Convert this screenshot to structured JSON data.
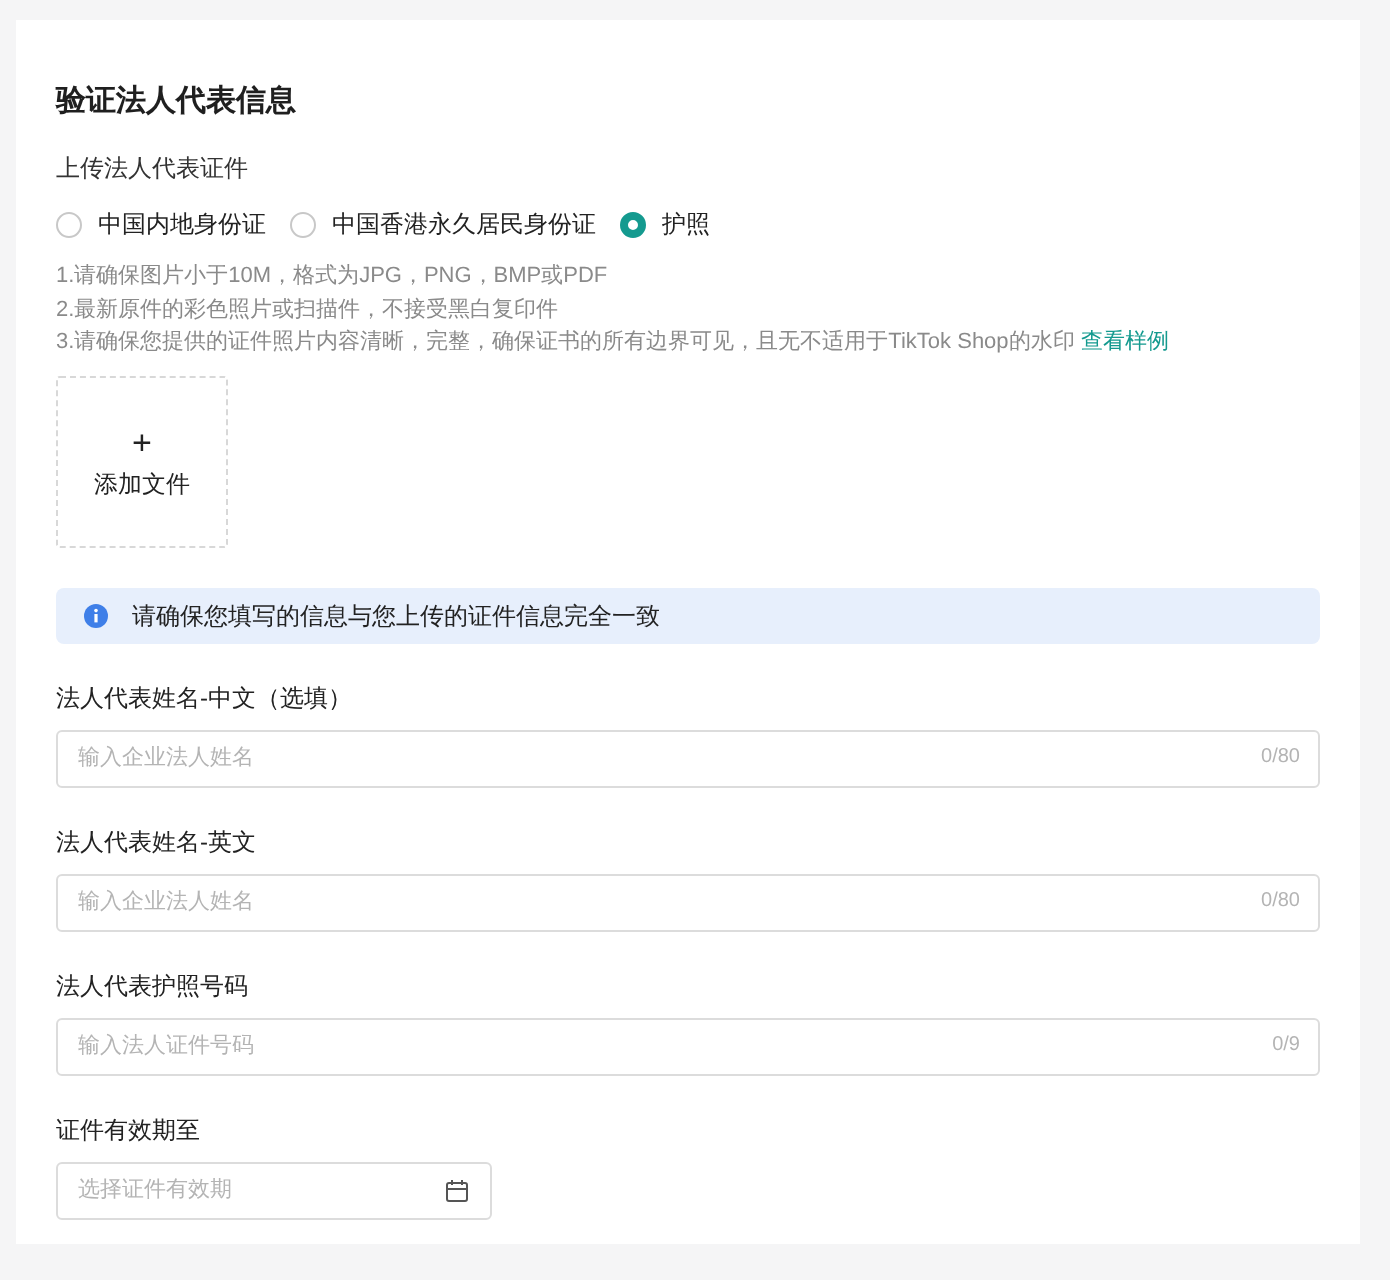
{
  "title": "验证法人代表信息",
  "upload": {
    "label": "上传法人代表证件",
    "id_types": [
      {
        "label": "中国内地身份证",
        "selected": false
      },
      {
        "label": "中国香港永久居民身份证",
        "selected": false
      },
      {
        "label": "护照",
        "selected": true
      }
    ],
    "hints": [
      "1.请确保图片小于10M，格式为JPG，PNG，BMP或PDF",
      "2.最新原件的彩色照片或扫描件，不接受黑白复印件",
      "3.请确保您提供的证件照片内容清晰，完整，确保证书的所有边界可见，且无不适用于TikTok Shop的水印"
    ],
    "sample_link": "查看样例",
    "add_file": {
      "icon": "+",
      "label": "添加文件"
    }
  },
  "notice": "请确保您填写的信息与您上传的证件信息完全一致",
  "fields": [
    {
      "kind": "text",
      "label": "法人代表姓名-中文（选填）",
      "placeholder": "输入企业法人姓名",
      "counter": "0/80"
    },
    {
      "kind": "text",
      "label": "法人代表姓名-英文",
      "placeholder": "输入企业法人姓名",
      "counter": "0/80"
    },
    {
      "kind": "text",
      "label": "法人代表护照号码",
      "placeholder": "输入法人证件号码",
      "counter": "0/9"
    },
    {
      "kind": "date",
      "label": "证件有效期至",
      "placeholder": "选择证件有效期"
    }
  ]
}
